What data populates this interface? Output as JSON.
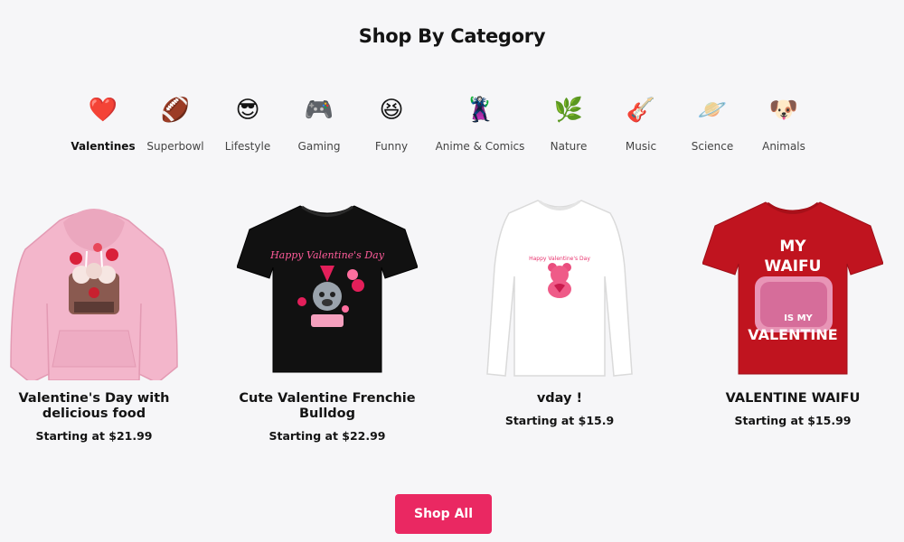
{
  "section": {
    "title": "Shop By Category"
  },
  "categories": [
    {
      "label": "Valentines",
      "icon": "heart-icon",
      "glyph": "❤️",
      "active": true
    },
    {
      "label": "Superbowl",
      "icon": "football-icon",
      "glyph": "🏈",
      "active": false
    },
    {
      "label": "Lifestyle",
      "icon": "sunglasses-face-icon",
      "glyph": "😎",
      "active": false
    },
    {
      "label": "Gaming",
      "icon": "gamepad-icon",
      "glyph": "🎮",
      "active": false
    },
    {
      "label": "Funny",
      "icon": "laughing-face-icon",
      "glyph": "😆",
      "active": false
    },
    {
      "label": "Anime & Comics",
      "icon": "supervillain-icon",
      "glyph": "🦹",
      "active": false
    },
    {
      "label": "Nature",
      "icon": "herb-icon",
      "glyph": "🌿",
      "active": false
    },
    {
      "label": "Music",
      "icon": "guitar-icon",
      "glyph": "🎸",
      "active": false
    },
    {
      "label": "Science",
      "icon": "ringed-planet-icon",
      "glyph": "🪐",
      "active": false
    },
    {
      "label": "Animals",
      "icon": "dog-face-icon",
      "glyph": "🐶",
      "active": false
    }
  ],
  "products": [
    {
      "title": "Valentine's Day with delicious food",
      "price": "Starting at $21.99",
      "garment": "hoodie",
      "color": "#f3b6cb"
    },
    {
      "title": "Cute Valentine Frenchie Bulldog",
      "price": "Starting at $22.99",
      "garment": "t-shirt",
      "color": "#111111",
      "print_text": "Happy Valentine's Day"
    },
    {
      "title": "vday !",
      "price": "Starting at $15.9",
      "garment": "long-sleeve",
      "color": "#ffffff",
      "print_text": "Happy Valentine's Day"
    },
    {
      "title": "VALENTINE WAIFU",
      "price": "Starting at $15.99",
      "garment": "t-shirt",
      "color": "#c0141f",
      "print_text": [
        "MY",
        "WAIFU",
        "IS MY",
        "VALENTINE"
      ]
    }
  ],
  "cta": {
    "label": "Shop All",
    "color": "#ea2862"
  }
}
